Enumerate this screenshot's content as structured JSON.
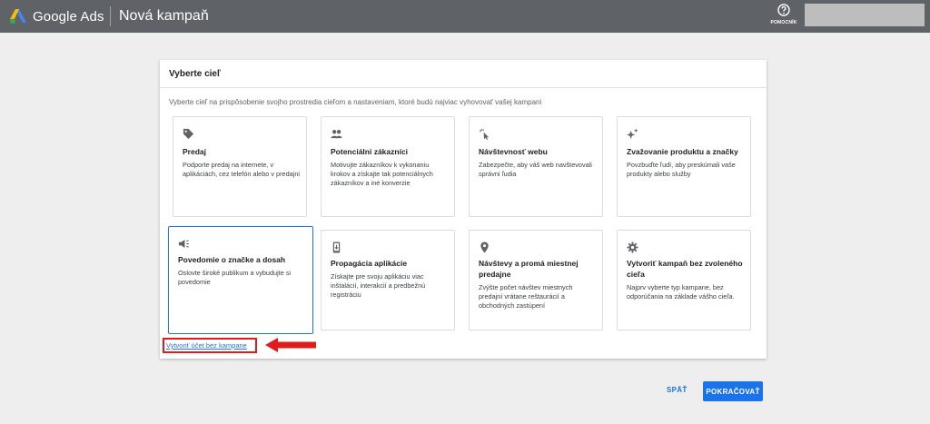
{
  "header": {
    "brand": "Google Ads",
    "title": "Nová kampaň",
    "help_label": "POMOCNÍK",
    "colors": {
      "bar": "#5f6368"
    }
  },
  "card": {
    "title": "Vyberte cieľ",
    "subtitle": "Vyberte cieľ na prispôsobenie svojho prostredia cieľom a nastaveniam, ktoré budú najviac vyhovovať vašej kampani"
  },
  "goals": [
    {
      "icon": "tag-icon",
      "title": "Predaj",
      "desc": "Podporte predaj na internete, v aplikáciách, cez telefón alebo v predajni"
    },
    {
      "icon": "people-icon",
      "title": "Potenciálni zákazníci",
      "desc": "Motivujte zákazníkov k vykonaniu krokov a získajte tak potenciálnych zákazníkov a iné konverzie"
    },
    {
      "icon": "cursor-click-icon",
      "title": "Návštevnosť webu",
      "desc": "Zabezpečte, aby váš web navštevovali správni ľudia"
    },
    {
      "icon": "sparkle-icon",
      "title": "Zvažovanie produktu a značky",
      "desc": "Povzbuďte ľudí, aby preskúmali vaše produkty alebo služby"
    },
    {
      "icon": "megaphone-icon",
      "title": "Povedomie o značke a dosah",
      "desc": "Oslovte široké publikum a vybudujte si povedomie",
      "selected": true
    },
    {
      "icon": "phone-app-icon",
      "title": "Propagácia aplikácie",
      "desc": "Získajte pre svoju aplikáciu viac inštalácií, interakcií a predbežnú registráciu"
    },
    {
      "icon": "location-pin-icon",
      "title": "Návštevy a promá miestnej predajne",
      "desc": "Zvýšte počet návštev miestnych predajní vrátane reštaurácií a obchodných zastúpení"
    },
    {
      "icon": "gear-icon",
      "title": "Vytvoriť kampaň bez zvoleného cieľa",
      "desc": "Najprv vyberte typ kampane, bez odporúčania na základe vášho cieľa."
    }
  ],
  "link": {
    "label": "Vytvoriť účet bez kampane"
  },
  "buttons": {
    "back": "SPÄŤ",
    "next": "POKRAČOVAŤ"
  },
  "colors": {
    "accent": "#1a73e8",
    "highlight": "#e01b1b"
  }
}
